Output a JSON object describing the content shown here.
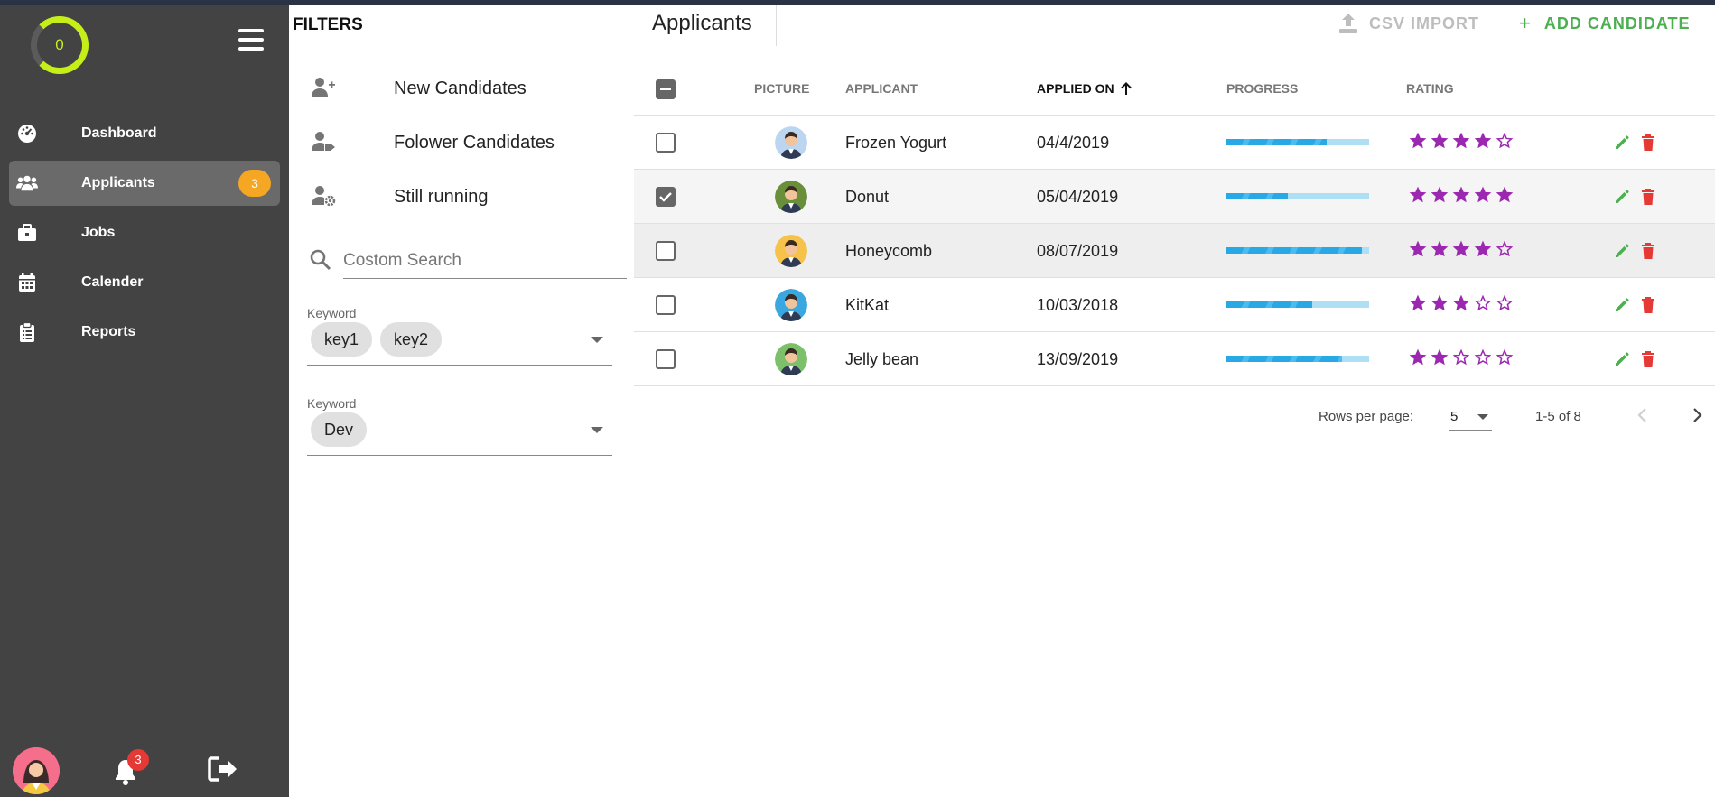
{
  "sidebar": {
    "progress_value": "0",
    "nav": [
      {
        "label": "Dashboard",
        "icon": "dashboard-icon"
      },
      {
        "label": "Applicants",
        "icon": "users-icon",
        "badge": "3"
      },
      {
        "label": "Jobs",
        "icon": "briefcase-icon"
      },
      {
        "label": "Calender",
        "icon": "calendar-icon"
      },
      {
        "label": "Reports",
        "icon": "clipboard-icon"
      }
    ],
    "notifications_count": "3"
  },
  "filters": {
    "title": "FILTERS",
    "items": [
      {
        "label": "New Candidates",
        "icon": "user-plus-icon"
      },
      {
        "label": "Folower Candidates",
        "icon": "user-tag-icon"
      },
      {
        "label": "Still running",
        "icon": "user-gear-icon"
      }
    ],
    "search": {
      "placeholder": "Costom Search"
    },
    "keyword1": {
      "label": "Keyword",
      "chips": [
        "key1",
        "key2"
      ]
    },
    "keyword2": {
      "label": "Keyword",
      "chips": [
        "Dev"
      ]
    }
  },
  "main": {
    "title": "Applicants",
    "csv_import": "CSV IMPORT",
    "add_candidate": "ADD CANDIDATE",
    "columns": {
      "picture": "PICTURE",
      "applicant": "APPLICANT",
      "applied_on": "APPLIED ON",
      "progress": "PROGRESS",
      "rating": "RATING"
    },
    "rows": [
      {
        "name": "Frozen Yogurt",
        "date": "04/4/2019",
        "progress": 0.7,
        "rating": 4,
        "checked": false,
        "avatar_color": "#bcd6f2"
      },
      {
        "name": "Donut",
        "date": "05/04/2019",
        "progress": 0.43,
        "rating": 5,
        "checked": true,
        "avatar_color": "#6a8f3a"
      },
      {
        "name": "Honeycomb",
        "date": "08/07/2019",
        "progress": 0.95,
        "rating": 4,
        "checked": false,
        "avatar_color": "#f6c24a"
      },
      {
        "name": "KitKat",
        "date": "10/03/2018",
        "progress": 0.6,
        "rating": 3,
        "checked": false,
        "avatar_color": "#3aa7e0"
      },
      {
        "name": "Jelly bean",
        "date": "13/09/2019",
        "progress": 0.81,
        "rating": 2,
        "checked": false,
        "avatar_color": "#7cc06a"
      }
    ],
    "pager": {
      "rows_per_page_label": "Rows per page:",
      "rows_per_page": "5",
      "range": "1-5 of 8"
    }
  },
  "colors": {
    "sidebar_bg": "#434343",
    "accent_ring": "#c6ef1a",
    "badge": "#f5a623",
    "add_green": "#4caf50",
    "star_purple": "#9c27b0",
    "delete_red": "#e53935",
    "progress_blue": "#29a8e6"
  }
}
